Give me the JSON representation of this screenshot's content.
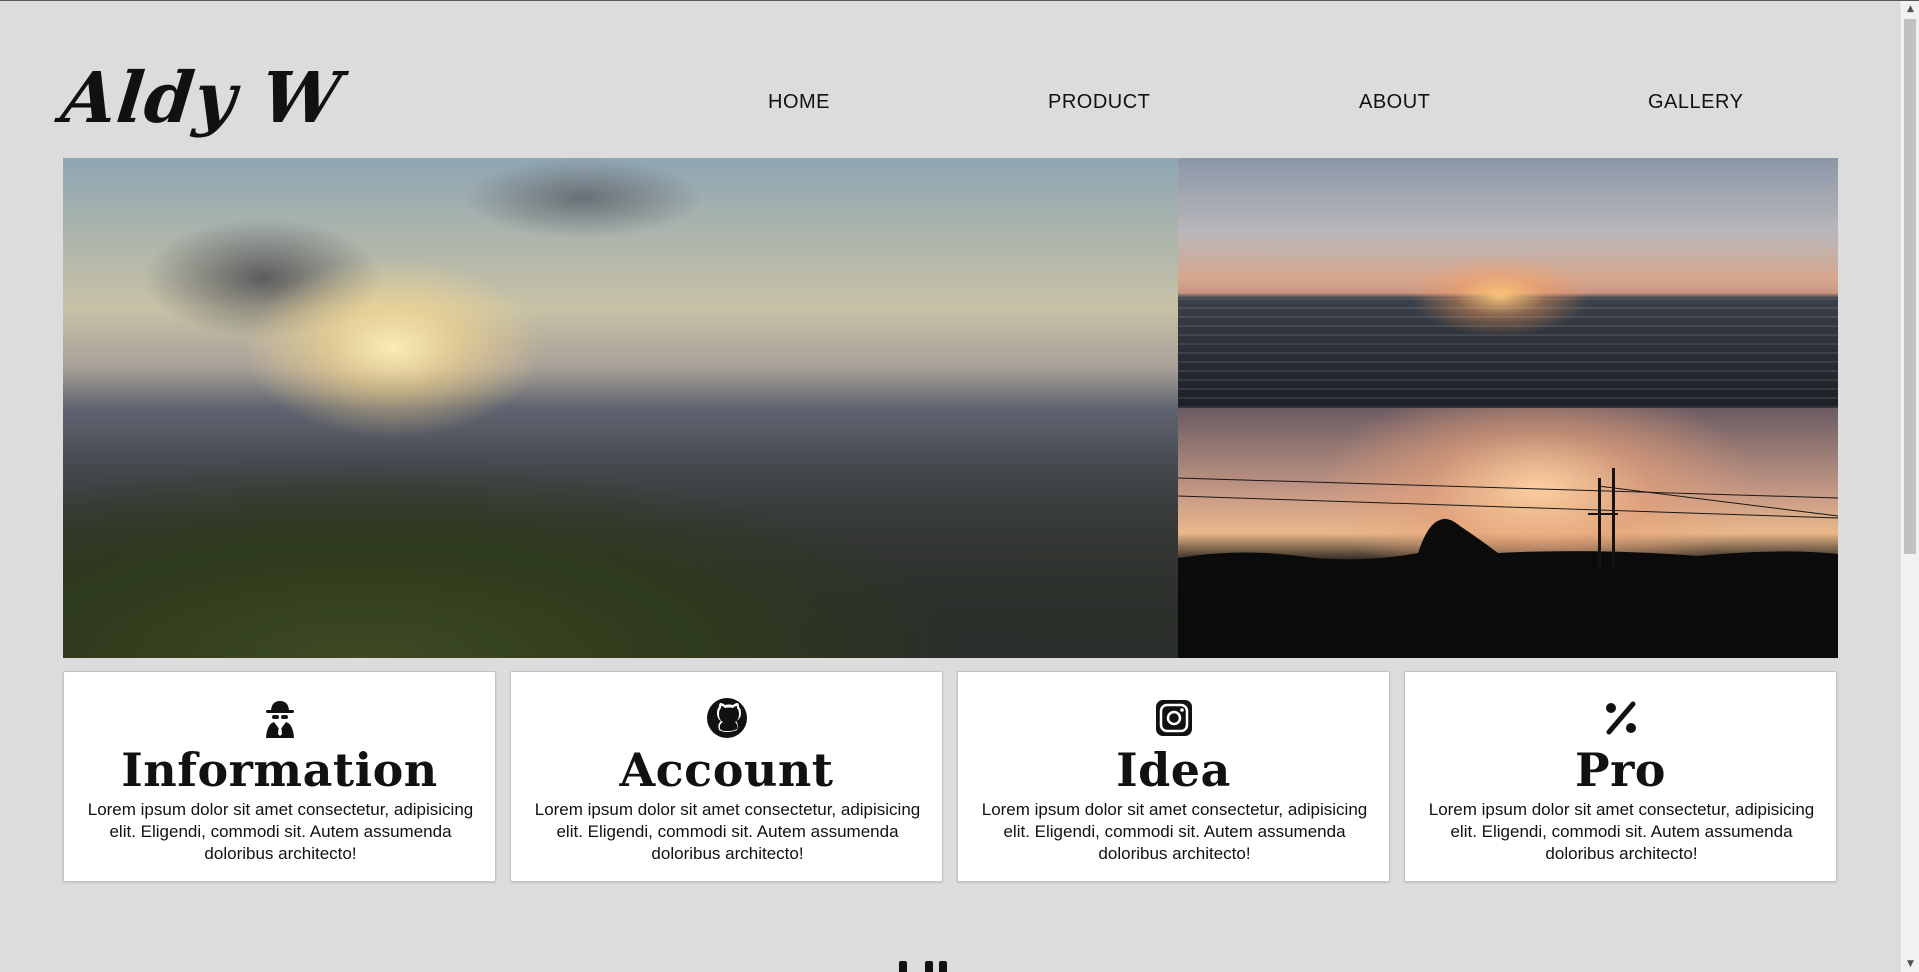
{
  "header": {
    "logo": "Aldy W",
    "nav": [
      {
        "label": "HOME"
      },
      {
        "label": "PRODUCT"
      },
      {
        "label": "ABOUT"
      },
      {
        "label": "GALLERY"
      }
    ]
  },
  "hero": {
    "images": [
      {
        "icon": "mountain-sunset-photo"
      },
      {
        "icon": "sea-sunset-photo"
      },
      {
        "icon": "power-line-sunset-photo"
      }
    ]
  },
  "cards": [
    {
      "icon": "spy-icon",
      "title": "Information",
      "text": "Lorem ipsum dolor sit amet consectetur, adipisicing elit. Eligendi, commodi sit. Autem assumenda doloribus architecto!"
    },
    {
      "icon": "github-icon",
      "title": "Account",
      "text": "Lorem ipsum dolor sit amet consectetur, adipisicing elit. Eligendi, commodi sit. Autem assumenda doloribus architecto!"
    },
    {
      "icon": "instagram-icon",
      "title": "Idea",
      "text": "Lorem ipsum dolor sit amet consectetur, adipisicing elit. Eligendi, commodi sit. Autem assumenda doloribus architecto!"
    },
    {
      "icon": "percent-icon",
      "title": "Pro",
      "text": "Lorem ipsum dolor sit amet consectetur, adipisicing elit. Eligendi, commodi sit. Autem assumenda doloribus architecto!"
    }
  ],
  "colors": {
    "background": "#dcdcdc",
    "card": "#ffffff",
    "text": "#111111"
  }
}
